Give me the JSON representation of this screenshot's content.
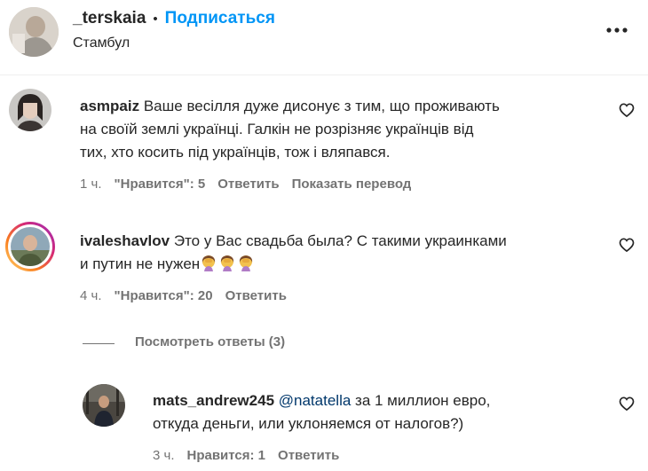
{
  "header": {
    "username": "_terskaia",
    "separator": "•",
    "follow_label": "Подписаться",
    "location": "Стамбул",
    "more_icon": "more-horizontal-icon"
  },
  "comments": [
    {
      "username": "asmpaiz",
      "text": "Ваше весілля дуже дисонує з тим, що проживають на своїй землі українці. Галкін не розрізняє українців від тих, хто косить під українців, тож і вляпався.",
      "line1": "Ваше весілля дуже дисонує з тим, що проживають",
      "line2": "на своїй землі українці. Галкін не розрізняє українців від",
      "line3": "тих, хто косить під українців, тож і вляпався.",
      "time": "1 ч.",
      "likes": "\"Нравится\": 5",
      "reply": "Ответить",
      "translate": "Показать перевод"
    },
    {
      "username": "ivaleshavlov",
      "line1": "Это у Вас свадьба была? С такими украинками",
      "line2": "и путин не нужен",
      "emojis": "🤦‍♀️🤦‍♀️🤦‍♀️",
      "time": "4 ч.",
      "likes": "\"Нравится\": 20",
      "reply": "Ответить",
      "view_replies": "Посмотреть ответы (3)"
    }
  ],
  "reply": {
    "username": "mats_andrew245",
    "mention": "@natatella",
    "line1": "за 1 миллион евро,",
    "line2": "откуда деньги, или уклоняемся от налогов?)",
    "time": "3 ч.",
    "likes": "Нравится: 1",
    "reply": "Ответить"
  },
  "colors": {
    "follow": "#0095f6",
    "meta": "#737373",
    "mention": "#00376b",
    "text": "#262626"
  }
}
